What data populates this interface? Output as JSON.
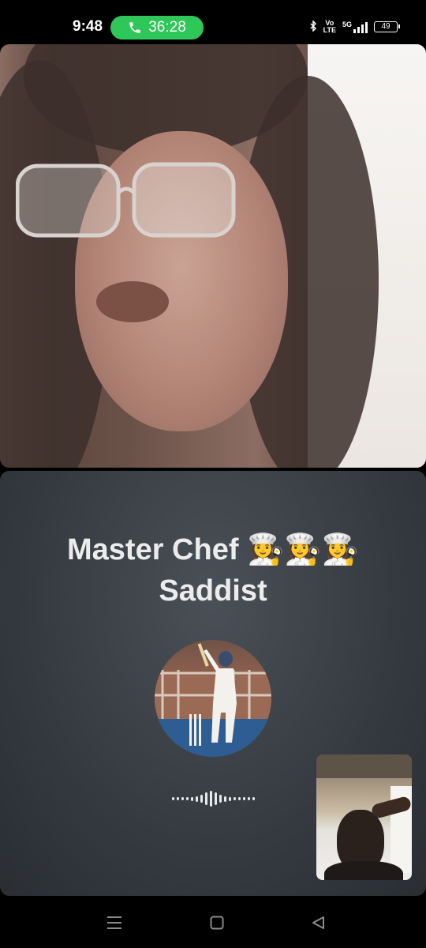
{
  "status_bar": {
    "time": "9:48",
    "call_timer": "36:28",
    "network_label_top": "Vo",
    "network_label_bottom": "LTE",
    "network_type": "5G",
    "battery_level": "49",
    "icons": [
      "bluetooth-icon",
      "volte-icon",
      "signal-icon",
      "battery-icon"
    ]
  },
  "call": {
    "group_name_line1": "Master Chef 👩‍🍳👩‍🍳👩‍🍳",
    "group_name_line2": "Saddist"
  },
  "colors": {
    "call_pill": "#2fc75a",
    "panel_bg": "#353a40",
    "background": "#000000"
  },
  "nav_bar": {
    "icons": [
      "recent-apps-icon",
      "home-icon",
      "back-icon"
    ]
  }
}
